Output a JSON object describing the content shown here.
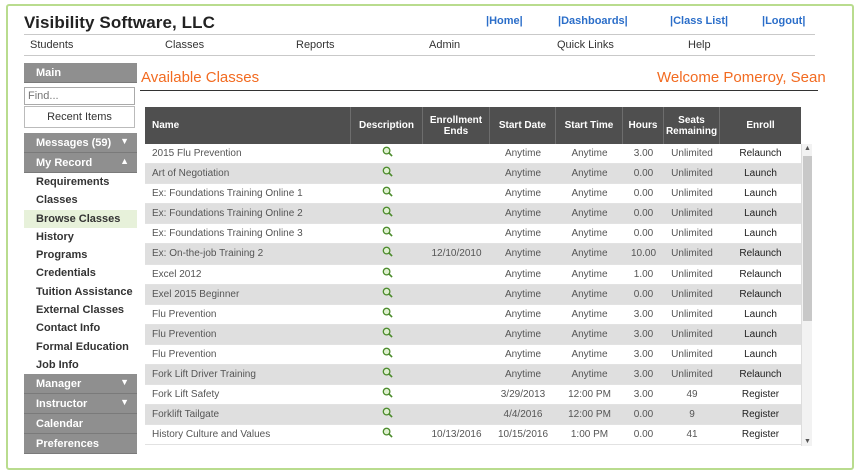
{
  "app_title": "Visibility Software, LLC",
  "top_links": [
    "|Home|",
    "|Dashboards|",
    "|Class List|",
    "|Logout|"
  ],
  "menu": [
    "Students",
    "Classes",
    "Reports",
    "Admin",
    "Quick Links",
    "Help"
  ],
  "sidebar": {
    "main_label": "Main",
    "find_placeholder": "Find...",
    "recent_label": "Recent Items",
    "messages_label": "Messages (59)",
    "my_record_label": "My Record",
    "my_record_items": [
      "Requirements",
      "Classes",
      "Browse Classes",
      "History",
      "Programs",
      "Credentials",
      "Tuition Assistance",
      "External Classes",
      "Contact Info",
      "Formal Education",
      "Job Info"
    ],
    "manager_label": "Manager",
    "instructor_label": "Instructor",
    "calendar_label": "Calendar",
    "preferences_label": "Preferences"
  },
  "page": {
    "heading": "Available Classes",
    "welcome": "Welcome Pomeroy, Sean"
  },
  "table": {
    "headers": [
      "Name",
      "Description",
      "Enrollment Ends",
      "Start Date",
      "Start Time",
      "Hours",
      "Seats Remaining",
      "Enroll"
    ],
    "rows": [
      {
        "name": "2015 Flu Prevention",
        "ends": "",
        "start_date": "Anytime",
        "start_time": "Anytime",
        "hours": "3.00",
        "seats": "Unlimited",
        "enroll": "Relaunch"
      },
      {
        "name": "Art of Negotiation",
        "ends": "",
        "start_date": "Anytime",
        "start_time": "Anytime",
        "hours": "0.00",
        "seats": "Unlimited",
        "enroll": "Launch"
      },
      {
        "name": "Ex: Foundations Training Online 1",
        "ends": "",
        "start_date": "Anytime",
        "start_time": "Anytime",
        "hours": "0.00",
        "seats": "Unlimited",
        "enroll": "Launch"
      },
      {
        "name": "Ex: Foundations Training Online 2",
        "ends": "",
        "start_date": "Anytime",
        "start_time": "Anytime",
        "hours": "0.00",
        "seats": "Unlimited",
        "enroll": "Launch"
      },
      {
        "name": "Ex: Foundations Training Online 3",
        "ends": "",
        "start_date": "Anytime",
        "start_time": "Anytime",
        "hours": "0.00",
        "seats": "Unlimited",
        "enroll": "Launch"
      },
      {
        "name": "Ex: On-the-job Training 2",
        "ends": "12/10/2010",
        "start_date": "Anytime",
        "start_time": "Anytime",
        "hours": "10.00",
        "seats": "Unlimited",
        "enroll": "Relaunch"
      },
      {
        "name": "Excel 2012",
        "ends": "",
        "start_date": "Anytime",
        "start_time": "Anytime",
        "hours": "1.00",
        "seats": "Unlimited",
        "enroll": "Relaunch"
      },
      {
        "name": "Exel 2015 Beginner",
        "ends": "",
        "start_date": "Anytime",
        "start_time": "Anytime",
        "hours": "0.00",
        "seats": "Unlimited",
        "enroll": "Relaunch"
      },
      {
        "name": "Flu Prevention",
        "ends": "",
        "start_date": "Anytime",
        "start_time": "Anytime",
        "hours": "3.00",
        "seats": "Unlimited",
        "enroll": "Launch"
      },
      {
        "name": "Flu Prevention",
        "ends": "",
        "start_date": "Anytime",
        "start_time": "Anytime",
        "hours": "3.00",
        "seats": "Unlimited",
        "enroll": "Launch"
      },
      {
        "name": "Flu Prevention",
        "ends": "",
        "start_date": "Anytime",
        "start_time": "Anytime",
        "hours": "3.00",
        "seats": "Unlimited",
        "enroll": "Launch"
      },
      {
        "name": "Fork Lift Driver Training",
        "ends": "",
        "start_date": "Anytime",
        "start_time": "Anytime",
        "hours": "3.00",
        "seats": "Unlimited",
        "enroll": "Relaunch"
      },
      {
        "name": "Fork Lift Safety",
        "ends": "",
        "start_date": "3/29/2013",
        "start_time": "12:00 PM",
        "hours": "3.00",
        "seats": "49",
        "enroll": "Register"
      },
      {
        "name": "Forklift Tailgate",
        "ends": "",
        "start_date": "4/4/2016",
        "start_time": "12:00 PM",
        "hours": "0.00",
        "seats": "9",
        "enroll": "Register"
      },
      {
        "name": "History Culture and Values",
        "ends": "10/13/2016",
        "start_date": "10/15/2016",
        "start_time": "1:00 PM",
        "hours": "0.00",
        "seats": "41",
        "enroll": "Register"
      }
    ]
  },
  "colors": {
    "accent": "#f26b21",
    "link": "#2b6ec9",
    "frame": "#b9dc8e",
    "header_bg": "#4f4f4f",
    "sidebar_head": "#8f8f8f"
  },
  "icons": {
    "description": "magnifier-icon",
    "collapse": "chevron-up-icon",
    "expand": "chevron-down-icon"
  }
}
